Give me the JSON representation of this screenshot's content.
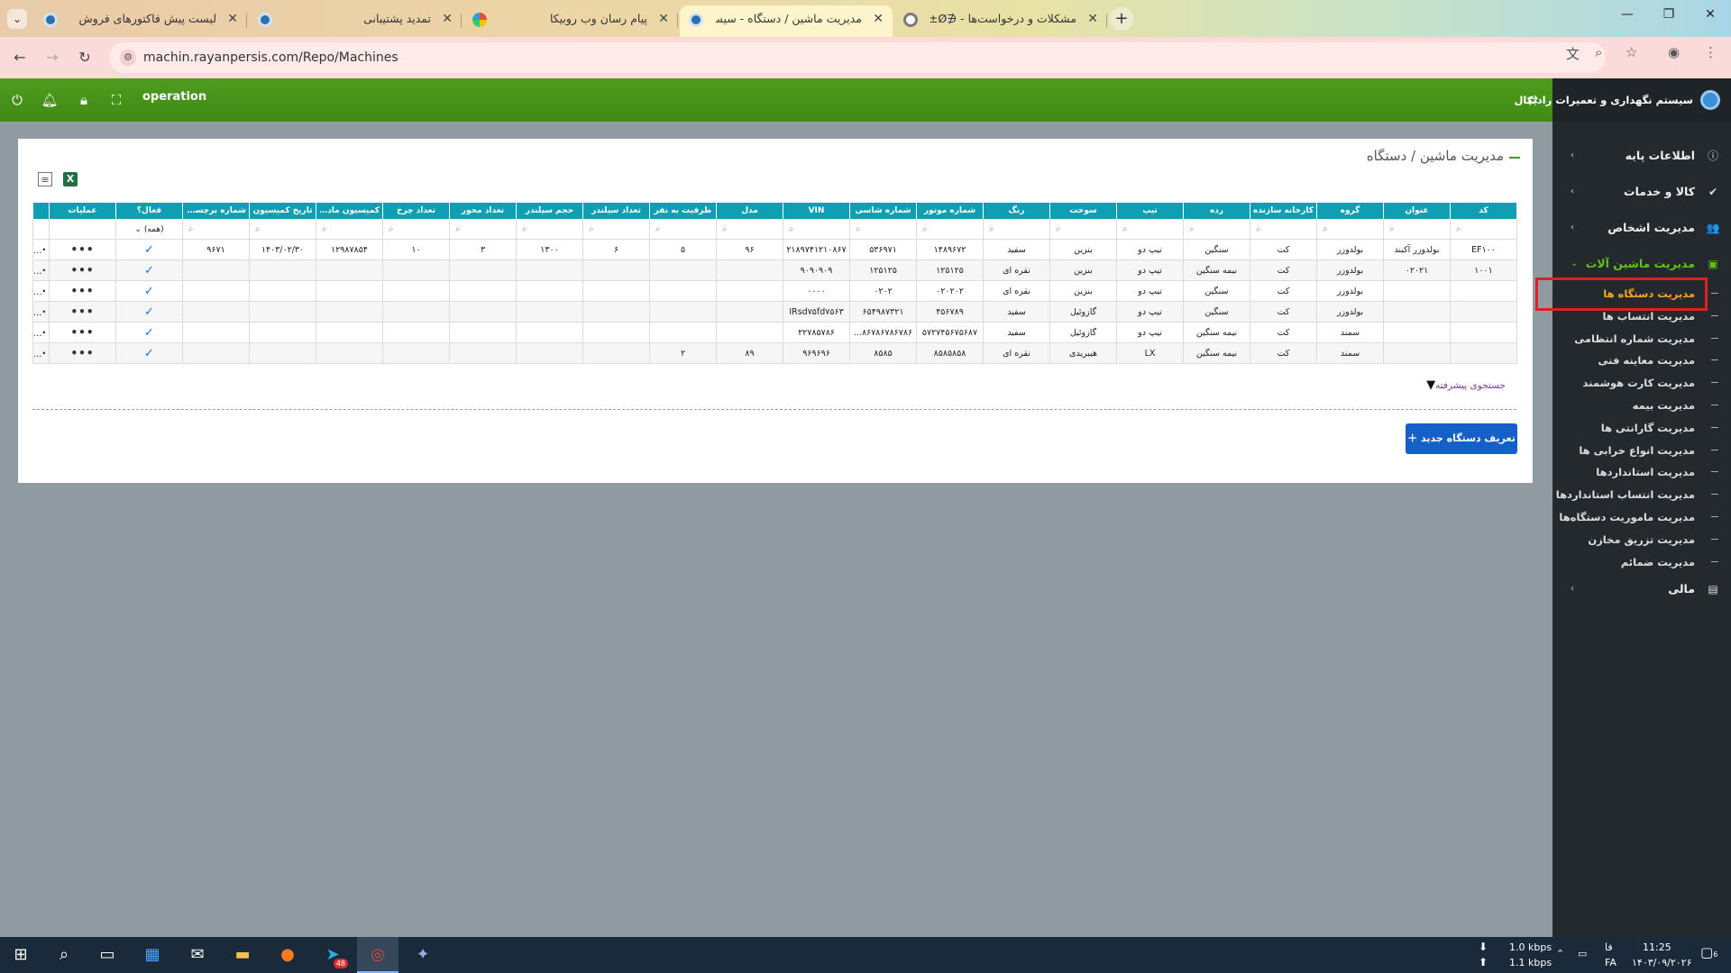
{
  "browser": {
    "tabs": [
      {
        "title": "لیست پیش فاکتورهای فروش",
        "favicon": "rayan-logo",
        "active": false
      },
      {
        "title": "تمدید پشتیبانی",
        "favicon": "rayan-logo",
        "active": false
      },
      {
        "title": "پیام رسان وب روبیکا",
        "favicon": "rubika-logo",
        "active": false
      },
      {
        "title": "مدیریت ماشین / دستگاه - سیست...",
        "favicon": "rayan-logo",
        "active": true
      },
      {
        "title": "مشکلات و درخواست‌ها - ∉ŒÙ±Ø",
        "favicon": "globe",
        "active": false
      }
    ],
    "new_tab": "+",
    "url": "machin.rayanpersis.com/Repo/Machines",
    "tab_menu": "⌄",
    "win_min": "—",
    "win_max": "❐",
    "win_close": "✕"
  },
  "header": {
    "user": "operation"
  },
  "sidebar": {
    "app_title": "سیستم نگهداری و تعمیرات رادیکال",
    "menus": [
      {
        "label": "اطلاعات پایه",
        "icon": "info-icon",
        "glyph": "ⓘ",
        "open": false
      },
      {
        "label": "کالا و خدمات",
        "icon": "check-icon",
        "glyph": "✔",
        "open": false
      },
      {
        "label": "مدیریت اشخاص",
        "icon": "users-icon",
        "glyph": "👥",
        "open": false
      },
      {
        "label": "مدیریت ماشین آلات",
        "icon": "car-icon",
        "glyph": "▣",
        "open": true
      }
    ],
    "submenu": [
      "مدیریت دستگاه ها",
      "مدیریت انتساب ها",
      "مدیریت شماره انتظامی",
      "مدیریت معاینه فنی",
      "مدیریت کارت هوشمند",
      "مدیریت بیمه",
      "مدیریت گارانتی ها",
      "مدیریت انواع خرابی ها",
      "مدیریت استانداردها",
      "مدیریت انتساب استانداردها",
      "مدیریت ماموریت دستگاه‌ها",
      "مدیریت تزریق مخازن",
      "مدیریت ضمائم"
    ],
    "active_submenu": "مدیریت دستگاه ها",
    "finance": {
      "label": "مالی",
      "glyph": "▤"
    }
  },
  "page": {
    "breadcrumb": "مدیریت ماشین / دستگاه",
    "advanced_search": "جستجوی پیشرفته",
    "add_button": "تعریف دستگاه جدید",
    "active_filter": "(همه)"
  },
  "grid": {
    "columns": [
      "کد",
      "عنوان",
      "گروه",
      "کارخانه سازنده",
      "رده",
      "تیپ",
      "سوخت",
      "رنگ",
      "شماره موتور",
      "شماره شاسی",
      "VIN",
      "مدل",
      "ظرفیت به نفر",
      "تعداد سیلندر",
      "حجم سیلندر",
      "تعداد محور",
      "تعداد چرخ",
      "کمیسیون ماده ۲",
      "تاریخ کمیسیون",
      "شماره برچسب د...",
      "فعال؟",
      "عملیات",
      ""
    ],
    "sorted_column": "گروه",
    "rows": [
      [
        "EF۱۰۰",
        "بولدوزر آکبند",
        "بولدوزر",
        "کت",
        "سنگین",
        "تیپ دو",
        "بنزین",
        "سفید",
        "۱۴۸۹۶۷۲",
        "۵۳۶۹۷۱",
        "۲۱۸۹۷۴۱۲۱۰۸۶۷",
        "۹۶",
        "۵",
        "۶",
        "۱۳۰۰",
        "۳",
        "۱۰",
        "۱۲۹۸۷۸۵۴",
        "۱۴۰۳/۰۲/۳۰",
        "۹۶۷۱"
      ],
      [
        "۱۰۰۱",
        "۰۲۰۲۱",
        "بولدوزر",
        "کت",
        "نیمه سنگین",
        "تیپ دو",
        "بنزین",
        "نقره ای",
        "۱۲۵۱۲۵",
        "۱۲۵۱۲۵",
        "۹۰۹۰۹۰۹",
        "",
        "",
        "",
        "",
        "",
        "",
        "",
        "",
        ""
      ],
      [
        "",
        "",
        "بولدوزر",
        "کت",
        "سنگین",
        "تیپ دو",
        "بنزین",
        "نقره ای",
        "۰۲۰۲۰۲",
        "۰۲۰۲",
        "۰۰۰۰",
        "",
        "",
        "",
        "",
        "",
        "",
        "",
        "",
        ""
      ],
      [
        "",
        "",
        "بولدوزر",
        "کت",
        "سنگین",
        "تیپ دو",
        "گازوئیل",
        "سفید",
        "۴۵۶۷۸۹",
        "۶۵۴۹۸۷۳۲۱",
        "IRsd۷۵fd۷۵۶۳",
        "",
        "",
        "",
        "",
        "",
        "",
        "",
        "",
        ""
      ],
      [
        "",
        "",
        "سمند",
        "کت",
        "نیمه سنگین",
        "تیپ دو",
        "گازوئیل",
        "سفید",
        "۵۷۲۷۴۵۶۷۵۶۸۷",
        "۸۶۷۸۶۷۸۶۷۸۶...",
        "۲۲۷۸۵۷۸۶",
        "",
        "",
        "",
        "",
        "",
        "",
        "",
        "",
        ""
      ],
      [
        "",
        "",
        "سمند",
        "کت",
        "نیمه سنگین",
        "LX",
        "هیبریدی",
        "نقره ای",
        "۸۵۸۵۸۵۸",
        "۸۵۸۵",
        "۹۶۹۶۹۶",
        "۸۹",
        "۲",
        "",
        "",
        "",
        "",
        "",
        "",
        ""
      ]
    ]
  },
  "taskbar": {
    "net_down": "1.0 kbps",
    "net_up": "1.1 kbps",
    "lang1": "فا",
    "lang2": "FA",
    "time": "11:25",
    "date": "۱۴۰۳/۰۹/۲۰۲۶",
    "notif_count": "6",
    "telegram_badge": "48"
  }
}
